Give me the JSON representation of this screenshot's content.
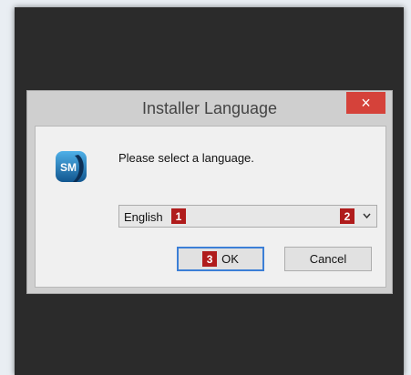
{
  "dialog": {
    "title": "Installer Language",
    "close_glyph": "×",
    "logo_text": "SM",
    "prompt": "Please select a language.",
    "language_select": {
      "value": "English",
      "arrow_icon": "chevron-down-icon"
    },
    "buttons": {
      "ok": "OK",
      "cancel": "Cancel"
    }
  },
  "badges": {
    "select": "1",
    "dropdown": "2",
    "ok": "3"
  },
  "colors": {
    "close": "#d5423a",
    "badge": "#b01c1c",
    "focus": "#3c7fd6",
    "logo": "#1a6fb8"
  }
}
